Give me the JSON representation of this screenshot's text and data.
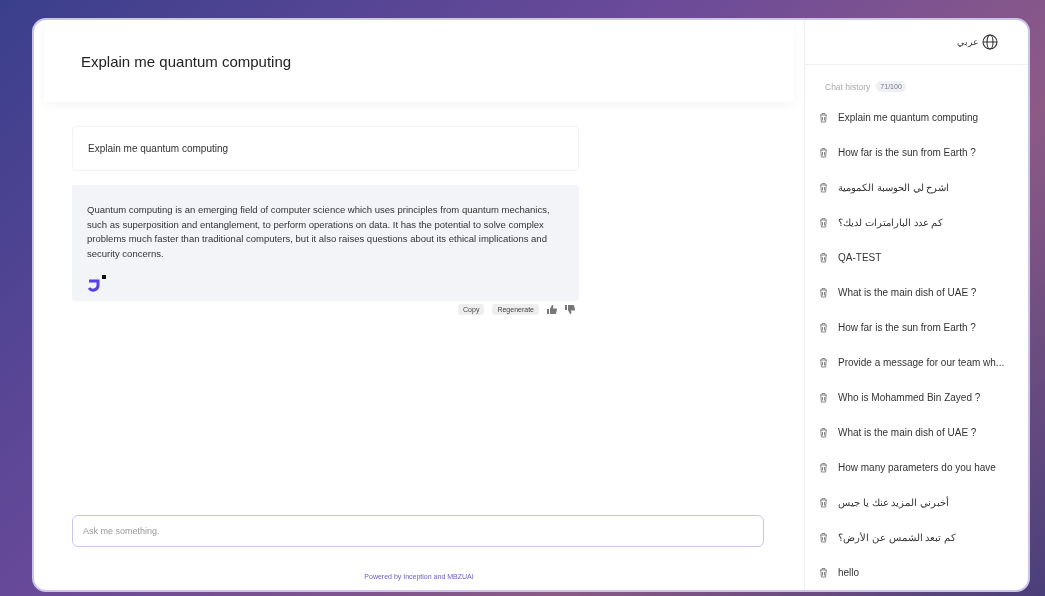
{
  "header": {
    "title": "Explain me quantum computing"
  },
  "conversation": {
    "user_message": "Explain me quantum computing",
    "assistant_message": "Quantum computing is an emerging field of computer science which uses principles from quantum mechanics, such as superposition and entanglement, to perform operations on data. It has the potential to solve complex problems much faster than traditional computers, but it also raises questions about its ethical implications and security concerns.",
    "actions": [
      "Copy",
      "Regenerate"
    ]
  },
  "composer": {
    "placeholder": "Ask me something."
  },
  "footer": "Powered by Inception and MBZUAI",
  "sidebar": {
    "language": "عربي",
    "history_label": "Chat history",
    "history_count": "71/100",
    "items": [
      "Explain me quantum computing",
      "How far is the sun from Earth ?",
      "اشرح لي الحوسبة الكمومية",
      "كم عدد البارامترات لديك؟",
      "QA-TEST",
      "What is the main dish of UAE ?",
      "How far is the sun from Earth ?",
      "Provide a message for our team wh...",
      "Who is Mohammed Bin Zayed ?",
      "What is the main dish of UAE ?",
      "How many parameters do you have",
      "أخبرني المزيد عنك يا جيس",
      "كم تبعد الشمس عن الأرض؟",
      "hello"
    ]
  }
}
